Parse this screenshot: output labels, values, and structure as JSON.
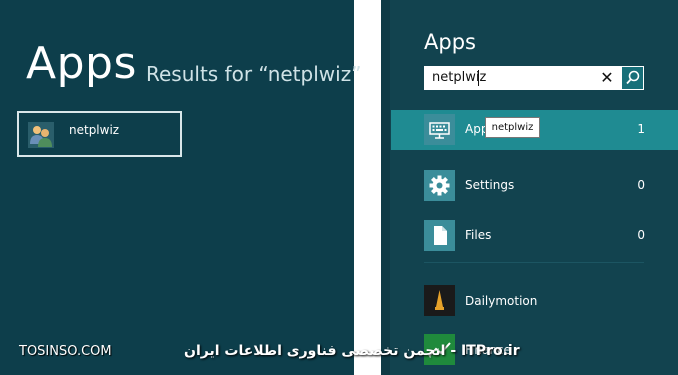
{
  "left_pane": {
    "title": "Apps",
    "results_text": "Results for “netplwiz”",
    "result_item": {
      "label": "netplwiz",
      "icon": "users-icon"
    }
  },
  "right_pane": {
    "title": "Apps",
    "search": {
      "value": "netplwiz",
      "clear_icon": "close-icon",
      "search_icon": "search-icon"
    },
    "categories": [
      {
        "label": "Apps",
        "count": "1",
        "icon": "keyboard-icon",
        "active": true
      },
      {
        "label": "Settings",
        "count": "0",
        "icon": "gear-icon",
        "active": false
      },
      {
        "label": "Files",
        "count": "0",
        "icon": "file-icon",
        "active": false
      }
    ],
    "tooltip": "netplwiz",
    "apps": [
      {
        "label": "Dailymotion",
        "icon": "dailymotion-icon"
      },
      {
        "label": "Finance",
        "icon": "finance-icon"
      }
    ]
  },
  "watermarks": {
    "left": "TOSINSO.COM",
    "right": "ITPro.ir - انجمن تخصصی فناوری اطلاعات ایران"
  },
  "colors": {
    "background": "#0d3e4b",
    "active_row": "#1f8b92",
    "accent": "#176f79"
  }
}
